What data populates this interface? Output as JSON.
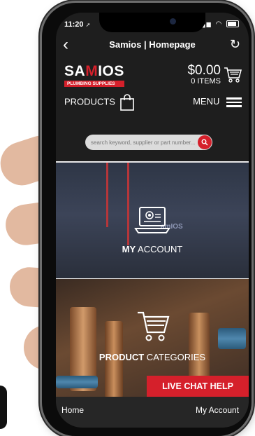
{
  "status_bar": {
    "time": "11:20",
    "location_arrow": "➚",
    "signal": "••••",
    "wifi": "⌒"
  },
  "nav": {
    "title": "Samios | Homepage",
    "back_glyph": "‹",
    "reload_glyph": "↻"
  },
  "brand": {
    "name_left": "SA",
    "name_mid": "M",
    "name_right": "IOS",
    "tagline": "PLUMBING SUPPLIES",
    "accent_color": "#d5202b"
  },
  "cart": {
    "amount": "$0.00",
    "items_label": "0 ITEMS",
    "icon": "cart-icon"
  },
  "header": {
    "products_label": "PRODUCTS",
    "menu_label": "MENU"
  },
  "search": {
    "placeholder": "search keyword, supplier or part number...",
    "value": ""
  },
  "tiles": {
    "account": {
      "bold": "MY",
      "rest": " ACCOUNT",
      "hoodie_print": "amIOS",
      "icon": "laptop-user-icon"
    },
    "categories": {
      "bold": "PRODUCT",
      "rest": " CATEGORIES",
      "icon": "shopping-cart-icon"
    }
  },
  "chat": {
    "label": "LIVE CHAT HELP"
  },
  "bottom_nav": {
    "home": "Home",
    "account": "My Account"
  }
}
